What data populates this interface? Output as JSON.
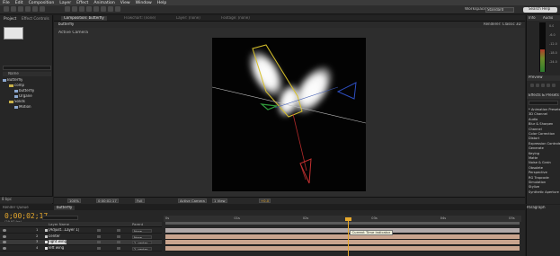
{
  "menu": [
    "File",
    "Edit",
    "Composition",
    "Layer",
    "Effect",
    "Animation",
    "View",
    "Window",
    "Help"
  ],
  "toolbar": {
    "workspace_label": "Workspace:",
    "workspace_value": "Standard",
    "search_placeholder": "Search Help"
  },
  "project": {
    "tabs": [
      "Project",
      "Effect Controls"
    ],
    "column_name": "Name",
    "items": [
      {
        "type": "comp",
        "label": "Butterfly"
      },
      {
        "type": "folder",
        "label": "comp"
      },
      {
        "type": "comp",
        "label": "butterfly"
      },
      {
        "type": "comp",
        "label": "Organe"
      },
      {
        "type": "folder",
        "label": "Solids"
      },
      {
        "type": "comp",
        "label": "Motion"
      }
    ],
    "footer_bpc": "8 bpc"
  },
  "composition": {
    "tab_label": "Composition: butterfly",
    "tabs_inactive": [
      "Flowchart: (none)",
      "Layer: (none)",
      "Footage: (none)"
    ],
    "sub_tab": "butterfly",
    "renderer": "Renderer: Classic 3D",
    "view_label": "Active Camera",
    "footer": {
      "zoom": "100%",
      "timecode": "0;00;02;17",
      "resolution": "Full",
      "view": "Active Camera",
      "views": "1 View",
      "exposure": "+0.0"
    }
  },
  "right": {
    "tabs": [
      "Info",
      "Audio"
    ],
    "db_values": [
      "0.0",
      "-6.0",
      "-12.0",
      "-18.0",
      "-24.0"
    ],
    "preview_tab": "Preview",
    "effects_tab": "Effects & Presets",
    "effects_items": [
      "* Animation Presets",
      "3D Channel",
      "Audio",
      "Blur & Sharpen",
      "Channel",
      "Color Correction",
      "Distort",
      "Expression Controls",
      "Generate",
      "Keying",
      "Matte",
      "Noise & Grain",
      "Obsolete",
      "Perspective",
      "RG Trapcode",
      "Simulation",
      "Stylize",
      "Synthetic Aperture"
    ]
  },
  "timeline": {
    "tabs": [
      "Render Queue",
      "butterfly"
    ],
    "timecode": "0;00;02;17",
    "fps": "(29.97 fps)",
    "columns": {
      "layer_name": "Layer Name",
      "parent": "Parent"
    },
    "layers": [
      {
        "num": "1",
        "name": "[Adjust...Layer 1]",
        "parent": "None",
        "color": "#c8c8c8",
        "bar": "#b0a8a8"
      },
      {
        "num": "2",
        "name": "center",
        "parent": "None",
        "color": "#c8c8c8",
        "bar": "#c9a48e"
      },
      {
        "num": "3",
        "name": "right wing",
        "parent": "2. center",
        "color": "#e3e3e3",
        "bar": "#c9a48e"
      },
      {
        "num": "4",
        "name": "left wing",
        "parent": "2. center",
        "color": "#e3e3e3",
        "bar": "#c9a48e"
      }
    ],
    "ruler_ticks": [
      "0s",
      "01s",
      "02s",
      "03s",
      "04s",
      "05s"
    ],
    "current_time": 2.57,
    "duration": 5,
    "cti_tooltip": "Current Time Indicator"
  },
  "paragraph": {
    "tab": "Paragraph"
  }
}
